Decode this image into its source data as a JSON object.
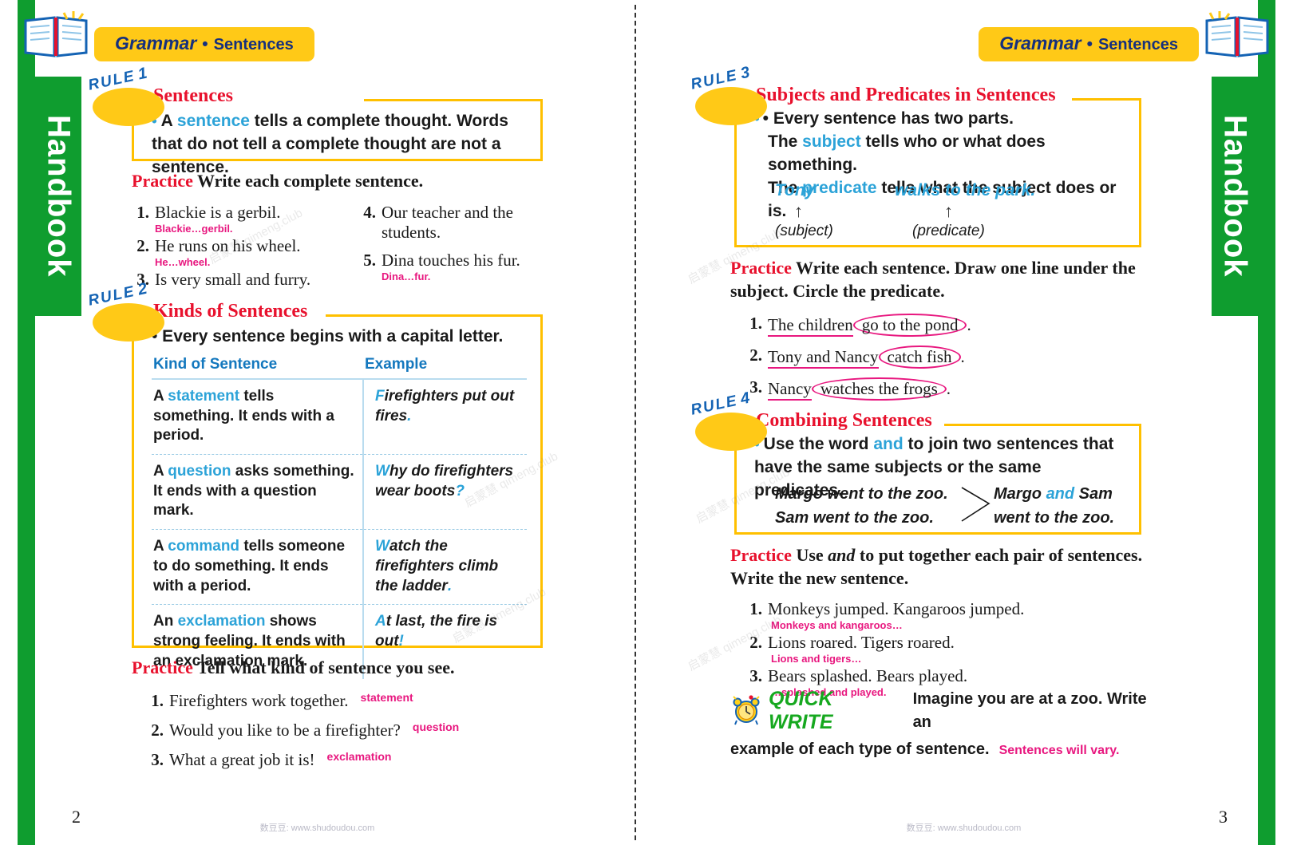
{
  "book": {
    "tab_label": "Handbook",
    "banner": {
      "subject": "Grammar",
      "dot": "•",
      "topic": "Sentences"
    },
    "footer_note": "数豆豆: www.shudoudou.com",
    "watermark": "启蒙慧  qimeng.club"
  },
  "left_page": {
    "page_number": "2",
    "rule1": {
      "badge": "RULE",
      "badge_num": "1",
      "title": "Sentences",
      "bullet_parts": [
        "• A ",
        "sentence",
        " tells a complete thought. Words that do not tell a complete thought are not a sentence."
      ],
      "keyword": "sentence"
    },
    "practice1": {
      "label": "Practice",
      "instruction": "Write each complete sentence.",
      "items_col1": [
        {
          "num": "1.",
          "text": "Blackie is a gerbil.",
          "answer": "Blackie…gerbil."
        },
        {
          "num": "2.",
          "text": "He runs on his wheel.",
          "answer": "He…wheel."
        },
        {
          "num": "3.",
          "text": "Is very small and furry.",
          "answer": ""
        }
      ],
      "items_col2": [
        {
          "num": "4.",
          "text": "Our teacher and the students.",
          "answer": ""
        },
        {
          "num": "5.",
          "text": "Dina touches his fur.",
          "answer": "Dina…fur."
        }
      ]
    },
    "rule2": {
      "badge": "RULE",
      "badge_num": "2",
      "title": "Kinds of Sentences",
      "bullet": "• Every sentence begins with a capital letter.",
      "table": {
        "headers": [
          "Kind of Sentence",
          "Example"
        ],
        "rows": [
          {
            "kind_pre": "A ",
            "kind_kw": "statement",
            "kind_post": " tells something. It ends with a period.",
            "ex_cap": "F",
            "ex_body": "irefighters put out fires",
            "ex_mark": "."
          },
          {
            "kind_pre": "A ",
            "kind_kw": "question",
            "kind_post": " asks something. It ends with a question mark.",
            "ex_cap": "W",
            "ex_body": "hy do firefighters wear boots",
            "ex_mark": "?"
          },
          {
            "kind_pre": "A ",
            "kind_kw": "command",
            "kind_post": " tells someone to do something. It ends with a period.",
            "ex_cap": "W",
            "ex_body": "atch the firefighters climb the ladder",
            "ex_mark": "."
          },
          {
            "kind_pre": "An ",
            "kind_kw": "exclamation",
            "kind_post": " shows strong feeling. It ends with an exclamation mark.",
            "ex_cap": "A",
            "ex_body": "t last, the fire is out",
            "ex_mark": "!"
          }
        ]
      }
    },
    "practice2": {
      "label": "Practice",
      "instruction": "Tell what kind of sentence you see.",
      "items": [
        {
          "num": "1.",
          "text": "Firefighters work together.",
          "answer": "statement"
        },
        {
          "num": "2.",
          "text": "Would you like to be a firefighter?",
          "answer": "question"
        },
        {
          "num": "3.",
          "text": "What a great job it is!",
          "answer": "exclamation"
        }
      ]
    }
  },
  "right_page": {
    "page_number": "3",
    "rule3": {
      "badge": "RULE",
      "badge_num": "3",
      "title": "Subjects and Predicates in Sentences",
      "line1": "• Every sentence has two parts.",
      "line2_pre": "The ",
      "line2_kw": "subject",
      "line2_post": " tells who or what does something.",
      "line3_pre": "The ",
      "line3_kw": "predicate",
      "line3_post": " tells what the subject does or is.",
      "example_subject": "Tony",
      "example_predicate": "walks to the park.",
      "arrow": "↑",
      "label_subject": "(subject)",
      "label_predicate": "(predicate)"
    },
    "practice3": {
      "label": "Practice",
      "instruction": "Write each sentence. Draw one line under the subject. Circle the predicate.",
      "items": [
        {
          "num": "1.",
          "subject": "The children",
          "predicate": "go to the pond",
          "end": "."
        },
        {
          "num": "2.",
          "subject": "Tony and Nancy",
          "predicate": "catch fish",
          "end": "."
        },
        {
          "num": "3.",
          "subject": "Nancy",
          "predicate": "watches the frogs",
          "end": "."
        }
      ]
    },
    "rule4": {
      "badge": "RULE",
      "badge_num": "4",
      "title": "Combining Sentences",
      "bullet_pre": "• Use the word ",
      "bullet_kw": "and",
      "bullet_post": " to join two sentences that have the same subjects or the same predicates.",
      "ex_a1": "Margo went to the zoo.",
      "ex_a2": "Sam went to the zoo.",
      "ex_b1_pre": "Margo ",
      "ex_b1_kw": "and",
      "ex_b1_post": " Sam",
      "ex_b2": "went to the zoo."
    },
    "practice4": {
      "label": "Practice",
      "instruction_pre": "Use ",
      "instruction_it": "and",
      "instruction_post": " to put together each pair of sentences. Write the new sentence.",
      "items": [
        {
          "num": "1.",
          "text": "Monkeys jumped. Kangaroos jumped.",
          "answer": "Monkeys and kangaroos…"
        },
        {
          "num": "2.",
          "text": "Lions roared. Tigers roared.",
          "answer": "Lions and tigers…"
        },
        {
          "num": "3.",
          "text": "Bears splashed. Bears played.",
          "answer": "…splashed and played."
        }
      ]
    },
    "quick_write": {
      "label": "QUICK WRITE",
      "icon": "alarm-clock-icon",
      "text_line1": "Imagine you are at a zoo. Write an",
      "text_line2": "example of each type of sentence.",
      "answer": "Sentences will vary."
    }
  },
  "colors": {
    "yellow": "#ffc917",
    "gold_border": "#ffc000",
    "red_title": "#e8112d",
    "blue_kw": "#2ca3d8",
    "blue_header": "#1478be",
    "green_tab": "#0f9d2f",
    "pink_answer": "#e8177f",
    "navy": "#16307d",
    "green_qw": "#16a81f"
  }
}
